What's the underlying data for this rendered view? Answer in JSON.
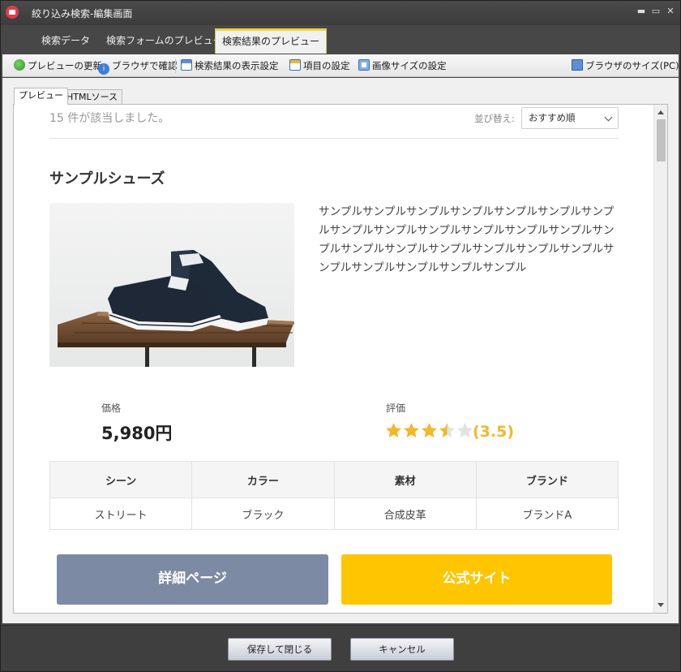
{
  "window": {
    "title": "絞り込み検索-編集画面",
    "controls": {
      "minimize": "▬",
      "maximize": "▭",
      "close": "✕"
    }
  },
  "nav_tabs": [
    {
      "label": "検索データ",
      "active": false
    },
    {
      "label": "検索フォームのプレビュー",
      "active": false
    },
    {
      "label": "検索結果のプレビュー",
      "active": true
    }
  ],
  "toolbar": {
    "refresh": {
      "label": "プレビューの更新",
      "icon": "refresh-icon"
    },
    "browser_check": {
      "label": "ブラウザで確認",
      "icon": "info-icon"
    },
    "result_display": {
      "label": "検索結果の表示設定",
      "icon": "grid-icon"
    },
    "item_settings": {
      "label": "項目の設定",
      "icon": "items-icon"
    },
    "image_size": {
      "label": "画像サイズの設定",
      "icon": "image-icon"
    },
    "browser_size": {
      "label": "ブラウザのサイズ(PC)",
      "icon": "monitor-icon"
    }
  },
  "sub_tabs": [
    {
      "label": "プレビュー",
      "active": true
    },
    {
      "label": "HTMLソース",
      "active": false
    }
  ],
  "preview": {
    "result_count": "15 件が該当しました。",
    "sort": {
      "label": "並び替え:",
      "value": "おすすめ順"
    },
    "product": {
      "title": "サンプルシューズ",
      "description": "サンプルサンプルサンプルサンプルサンプルサンプルサンプルサンプルサンプルサンプルサンプルサンプルサンプルサンプルサンプルサンプルサンプルサンプルサンプルサンプルサンプルサンプルサンプルサンプルサンプル",
      "price_label": "価格",
      "price": "5,980円",
      "rating_label": "評価",
      "rating": 3.5,
      "rating_text": "(3.5)",
      "specs": {
        "headers": [
          "シーン",
          "カラー",
          "素材",
          "ブランド"
        ],
        "values": [
          "ストリート",
          "ブラック",
          "合成皮革",
          "ブランドA"
        ]
      },
      "detail_button": "詳細ページ",
      "official_button": "公式サイト"
    }
  },
  "footer": {
    "save_close": "保存して閉じる",
    "cancel": "キャンセル"
  },
  "colors": {
    "accent_tab": "#f0d23b",
    "detail_button": "#7d8aa3",
    "official_button": "#ffc600",
    "star": "#f5b72a"
  }
}
